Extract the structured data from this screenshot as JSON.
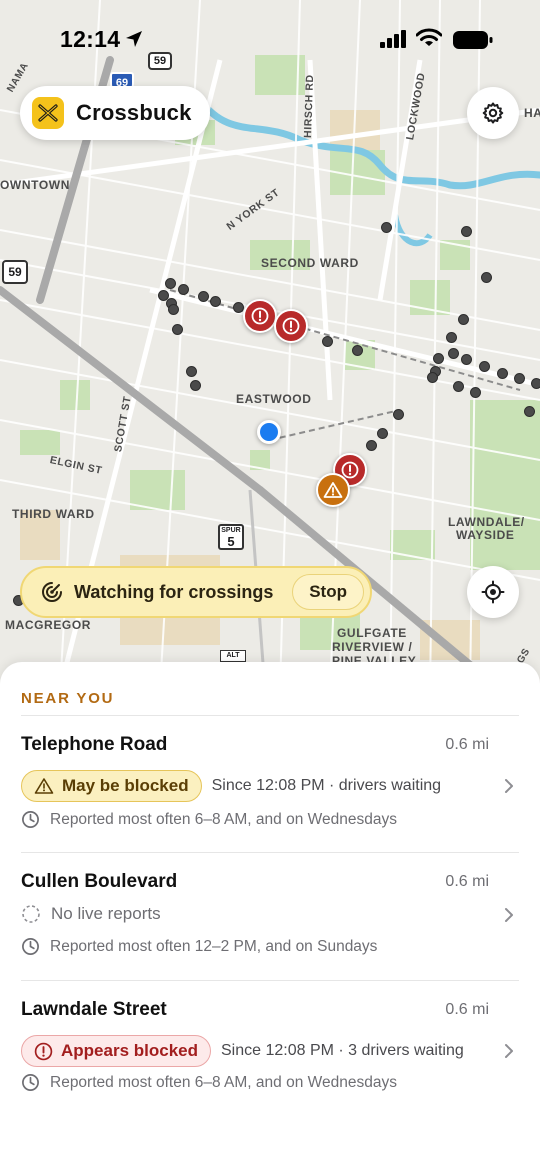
{
  "status_bar": {
    "time": "12:14"
  },
  "app": {
    "name": "Crossbuck"
  },
  "map": {
    "labels": {
      "downtown": "OWNTOWN",
      "second_ward": "SECOND WARD",
      "eastwood": "EASTWOOD",
      "third_ward": "THIRD WARD",
      "lawndale_wayside_1": "LAWNDALE/",
      "lawndale_wayside_2": "WAYSIDE",
      "macgregor": "MACGREGOR",
      "gulfgate_1": "GULFGATE",
      "gulfgate_2": "RIVERVIEW /",
      "gulfgate_3": "PINE VALLEY",
      "n_york_st": "N YORK ST",
      "hirsch_rd": "HIRSCH RD",
      "lockwood": "LOCKWOOD",
      "scott_st": "SCOTT ST",
      "elgin_st": "ELGIN ST",
      "ha": "HA",
      "nama": "NAMA",
      "rgs": "RGS"
    },
    "shields": {
      "i69": "69",
      "us59_top": "59",
      "us59_left": "59",
      "spur_label": "SPUR",
      "spur_num": "5",
      "alt": "ALT"
    }
  },
  "watching": {
    "label": "Watching for crossings",
    "stop_label": "Stop"
  },
  "near_you": {
    "heading": "NEAR YOU",
    "items": [
      {
        "title": "Telephone Road",
        "distance": "0.6 mi",
        "status": "May be blocked",
        "status_kind": "maybe",
        "since": "Since 12:08 PM · drivers waiting",
        "history": "Reported most often 6–8 AM, and on Wednesdays"
      },
      {
        "title": "Cullen Boulevard",
        "distance": "0.6 mi",
        "status": "No live reports",
        "status_kind": "none",
        "since": "",
        "history": "Reported most often 12–2 PM, and on Sundays"
      },
      {
        "title": "Lawndale Street",
        "distance": "0.6 mi",
        "status": "Appears blocked",
        "status_kind": "blocked",
        "since": "Since 12:08 PM · 3 drivers waiting",
        "history": "Reported most often 6–8 AM, and on Wednesdays"
      }
    ]
  },
  "colors": {
    "accent": "#b26a13",
    "blocked": "#b82a2a",
    "maybe": "#c8700f",
    "location": "#1b7cf0",
    "brand": "#f4c21b"
  }
}
